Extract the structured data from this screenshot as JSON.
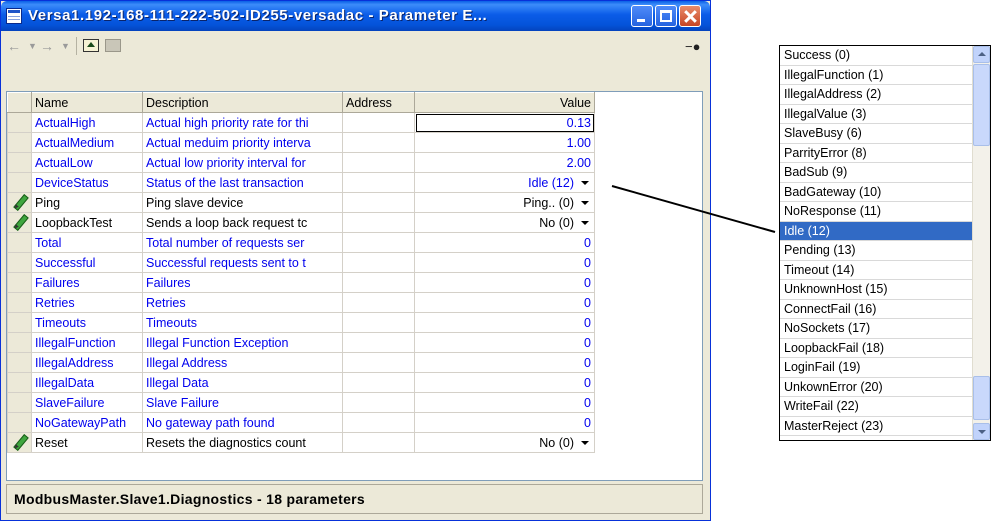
{
  "window": {
    "title": "Versa1.192-168-111-222-502-ID255-versadac - Parameter E..."
  },
  "toolbar": {
    "back_icon": "back-arrow-icon",
    "forward_icon": "forward-arrow-icon",
    "up_icon": "up-folder-icon",
    "folder_icon": "folder-icon",
    "pin_icon": "pin-icon"
  },
  "table": {
    "headers": {
      "name": "Name",
      "description": "Description",
      "address": "Address",
      "value": "Value"
    },
    "rows": [
      {
        "name": "ActualHigh",
        "description": "Actual high priority rate for thi",
        "address": "",
        "value": "0.13"
      },
      {
        "name": "ActualMedium",
        "description": "Actual meduim priority interva",
        "address": "",
        "value": "1.00"
      },
      {
        "name": "ActualLow",
        "description": "Actual low priority interval for",
        "address": "",
        "value": "2.00"
      },
      {
        "name": "DeviceStatus",
        "description": "Status of the last transaction",
        "address": "",
        "value": "Idle (12)"
      },
      {
        "name": "Ping",
        "description": "Ping slave device",
        "address": "",
        "value": "Ping.. (0)"
      },
      {
        "name": "LoopbackTest",
        "description": "Sends a loop back request tc",
        "address": "",
        "value": "No (0)"
      },
      {
        "name": "Total",
        "description": "Total number of requests ser",
        "address": "",
        "value": "0"
      },
      {
        "name": "Successful",
        "description": "Successful requests sent to t",
        "address": "",
        "value": "0"
      },
      {
        "name": "Failures",
        "description": "Failures",
        "address": "",
        "value": "0"
      },
      {
        "name": "Retries",
        "description": "Retries",
        "address": "",
        "value": "0"
      },
      {
        "name": "Timeouts",
        "description": "Timeouts",
        "address": "",
        "value": "0"
      },
      {
        "name": "IllegalFunction",
        "description": "Illegal Function Exception",
        "address": "",
        "value": "0"
      },
      {
        "name": "IllegalAddress",
        "description": "Illegal Address",
        "address": "",
        "value": "0"
      },
      {
        "name": "IllegalData",
        "description": "Illegal Data",
        "address": "",
        "value": "0"
      },
      {
        "name": "SlaveFailure",
        "description": "Slave Failure",
        "address": "",
        "value": "0"
      },
      {
        "name": "NoGatewayPath",
        "description": "No gateway path found",
        "address": "",
        "value": "0"
      },
      {
        "name": "Reset",
        "description": "Resets the diagnostics count",
        "address": "",
        "value": "No (0)"
      }
    ]
  },
  "status": "ModbusMaster.Slave1.Diagnostics  -  18 parameters",
  "status_list": {
    "items": [
      "Success (0)",
      "IllegalFunction (1)",
      "IllegalAddress (2)",
      "IllegalValue (3)",
      "SlaveBusy (6)",
      "ParrityError (8)",
      "BadSub (9)",
      "BadGateway (10)",
      "NoResponse (11)",
      "Idle (12)",
      "Pending (13)",
      "Timeout (14)",
      "UnknownHost (15)",
      "ConnectFail (16)",
      "NoSockets (17)",
      "LoopbackFail (18)",
      "LoginFail (19)",
      "UnkownError (20)",
      "WriteFail (22)",
      "MasterReject (23)"
    ],
    "selected": "Idle (12)"
  },
  "colors": {
    "link_blue": "#0000ee",
    "selection": "#316ac5",
    "title_blue": "#0453d9"
  }
}
